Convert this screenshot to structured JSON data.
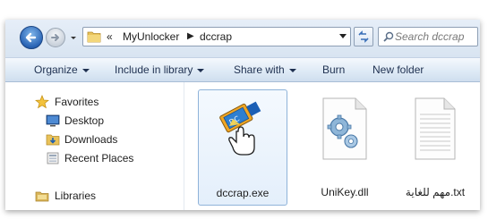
{
  "address": {
    "overflow": "«",
    "crumbs": [
      "MyUnlocker",
      "dccrap"
    ]
  },
  "search": {
    "placeholder": "Search dccrap"
  },
  "toolbar": {
    "organize": "Organize",
    "include": "Include in library",
    "share": "Share with",
    "burn": "Burn",
    "new_folder": "New folder"
  },
  "nav": {
    "favorites": "Favorites",
    "desktop": "Desktop",
    "downloads": "Downloads",
    "recent": "Recent Places",
    "libraries": "Libraries"
  },
  "files": [
    {
      "name": "dccrap.exe",
      "icon": "exe-app-icon",
      "selected": true
    },
    {
      "name": "UniKey.dll",
      "icon": "dll-gear-icon",
      "selected": false
    },
    {
      "name": "مهم للغاية.txt",
      "icon": "text-file-icon",
      "selected": false
    }
  ],
  "colors": {
    "accent": "#2a64b5",
    "selection_border": "#8fb3d9",
    "toolbar_text": "#1e3050"
  }
}
